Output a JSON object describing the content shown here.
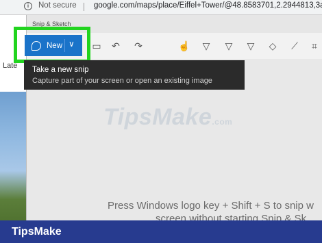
{
  "browser": {
    "security_text": "Not secure",
    "url": "google.com/maps/place/Eiffel+Tower/@48.8583701,2.2944813,3a,10"
  },
  "background_page": {
    "partial_text": "Late"
  },
  "snip_app": {
    "title": "Snip & Sketch",
    "new_button_label": "New",
    "toolbar_icons": [
      "undo-icon",
      "redo-icon",
      "touch-writing-icon",
      "ballpoint-pen-icon",
      "pencil-icon",
      "highlighter-icon",
      "eraser-icon",
      "ruler-icon",
      "crop-icon"
    ],
    "canvas_hint_line1": "Press Windows logo key + Shift + S to snip w",
    "canvas_hint_line2": "screen without starting Snip & Sk"
  },
  "tooltip": {
    "title": "Take a new snip",
    "description": "Capture part of your screen or open an existing image"
  },
  "watermark": {
    "text": "TipsMake",
    "suffix": ".com"
  },
  "brand": {
    "name": "TipsMake"
  },
  "colors": {
    "new_button": "#1a73c9",
    "highlight": "#22d41f",
    "brand_bar": "#273b8f",
    "tooltip_bg": "#2b2b2b"
  }
}
